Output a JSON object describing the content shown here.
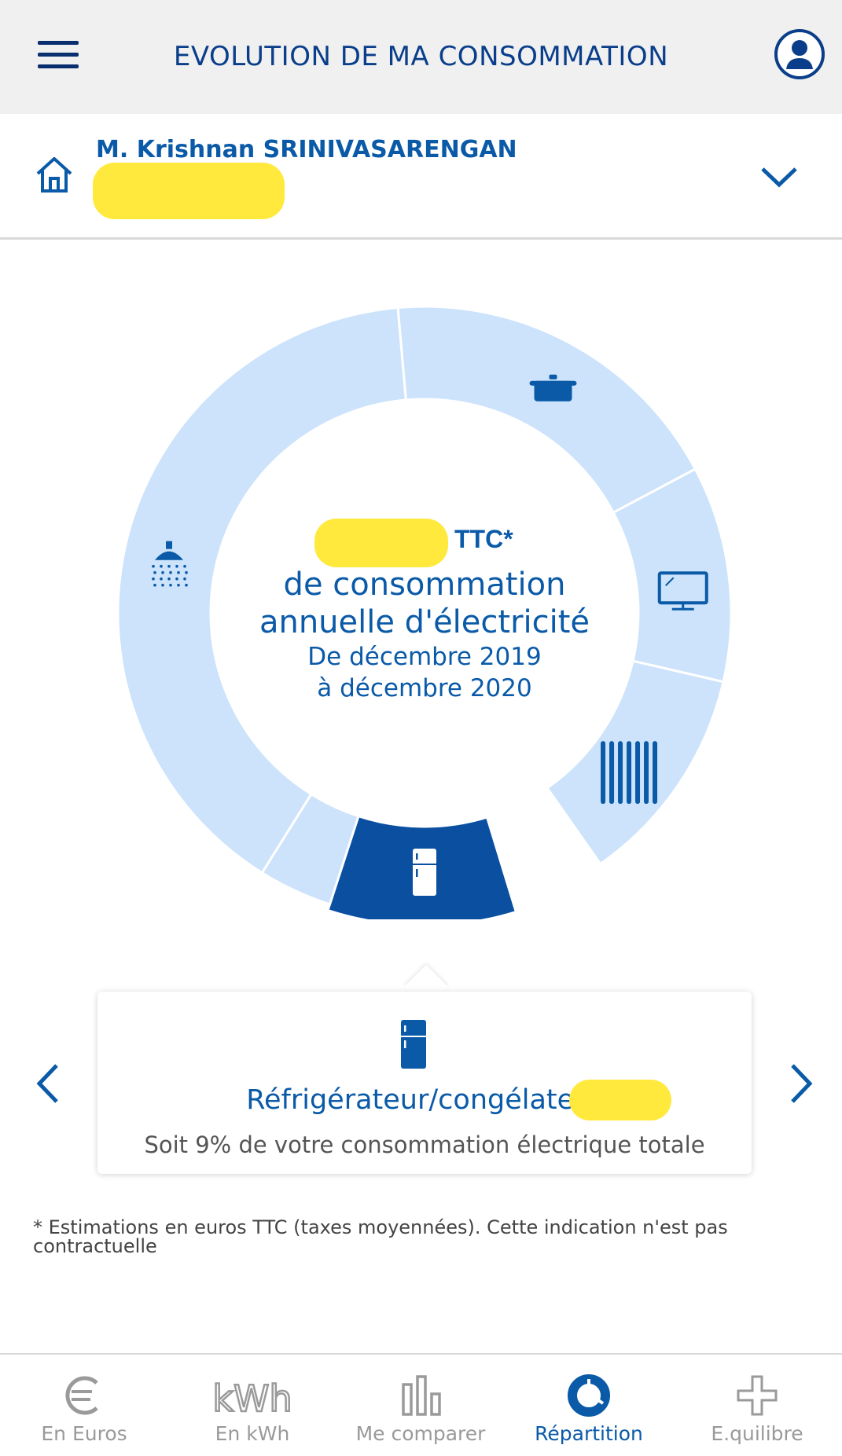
{
  "header": {
    "title": "EVOLUTION DE MA CONSOMMATION"
  },
  "contract": {
    "customer_name": "M. Krishnan SRINIVASARENGAN"
  },
  "summary": {
    "amount_suffix": "TTC*",
    "line1": "de consommation",
    "line2": "annuelle d'électricité",
    "line3": "De décembre 2019",
    "line4": "à décembre 2020"
  },
  "chart_data": {
    "type": "donut",
    "segments": [
      {
        "icon": "cooking-pot-icon",
        "selected": false
      },
      {
        "icon": "tv-icon",
        "selected": false
      },
      {
        "icon": "heater-icon",
        "selected": false
      },
      {
        "icon": "fridge-icon",
        "selected": true,
        "percent": 9
      },
      {
        "icon": "unlabeled",
        "selected": false
      },
      {
        "icon": "shower-icon",
        "selected": false
      }
    ],
    "colors": {
      "segment": "#cce3fb",
      "selected": "#0a4fa0",
      "icon": "#0a5aa8",
      "divider": "#ffffff"
    }
  },
  "detail": {
    "title": "Réfrigérateur/congélateur",
    "subtitle": "Soit 9% de votre consommation électrique totale"
  },
  "footnote": "* Estimations en euros TTC (taxes moyennées). Cette indication n'est pas contractuelle",
  "tabs": [
    {
      "label": "En Euros",
      "icon": "euro-icon",
      "active": false
    },
    {
      "label": "En kWh",
      "icon": "kwh-icon",
      "active": false
    },
    {
      "label": "Me comparer",
      "icon": "bar-chart-icon",
      "active": false
    },
    {
      "label": "Répartition",
      "icon": "donut-icon",
      "active": true
    },
    {
      "label": "E.quilibre",
      "icon": "plus-icon",
      "active": false
    }
  ]
}
